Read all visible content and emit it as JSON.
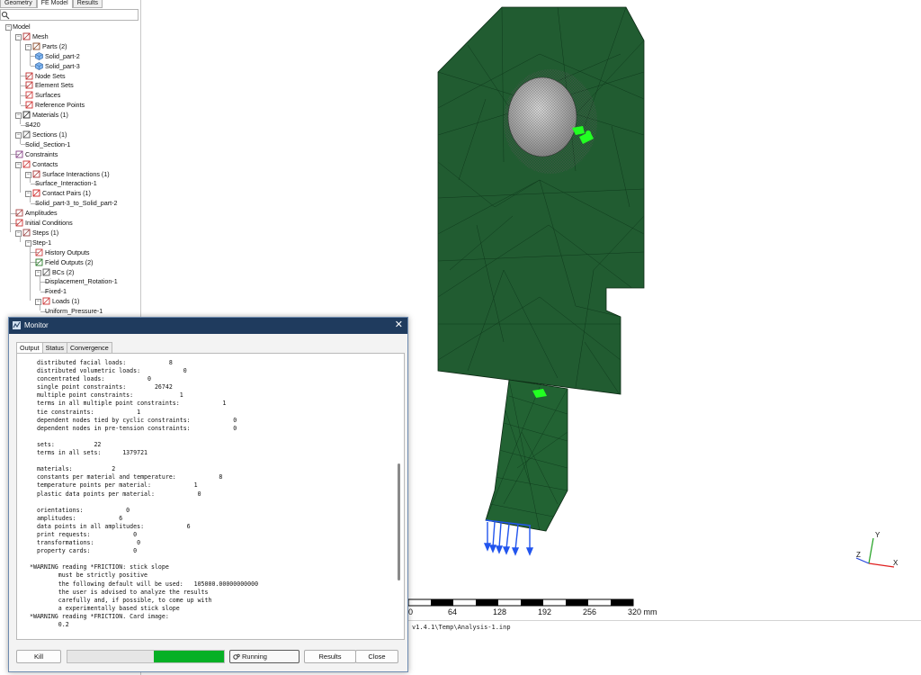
{
  "left_panel": {
    "tabs": [
      {
        "label": "Geometry",
        "active": false
      },
      {
        "label": "FE Model",
        "active": true
      },
      {
        "label": "Results",
        "active": false
      }
    ],
    "search_placeholder": "",
    "tree": [
      {
        "label": "Model",
        "icon": "none",
        "level": 0
      },
      {
        "label": "Mesh",
        "icon": "mesh-icon",
        "level": 1
      },
      {
        "label": "Parts (2)",
        "icon": "parts-icon",
        "level": 2
      },
      {
        "label": "Solid_part-2",
        "icon": "solid-part-icon",
        "level": 3
      },
      {
        "label": "Solid_part-3",
        "icon": "solid-part-icon",
        "level": 3
      },
      {
        "label": "Node Sets",
        "icon": "node-sets-icon",
        "level": 2
      },
      {
        "label": "Element Sets",
        "icon": "element-sets-icon",
        "level": 2
      },
      {
        "label": "Surfaces",
        "icon": "surfaces-icon",
        "level": 2
      },
      {
        "label": "Reference Points",
        "icon": "reference-points-icon",
        "level": 2
      },
      {
        "label": "Materials (1)",
        "icon": "materials-icon",
        "level": 1
      },
      {
        "label": "S420",
        "icon": "none",
        "level": 2
      },
      {
        "label": "Sections (1)",
        "icon": "sections-icon",
        "level": 1
      },
      {
        "label": "Solid_Section-1",
        "icon": "none",
        "level": 2
      },
      {
        "label": "Constraints",
        "icon": "constraints-icon",
        "level": 1
      },
      {
        "label": "Contacts",
        "icon": "contacts-icon",
        "level": 1
      },
      {
        "label": "Surface Interactions (1)",
        "icon": "surface-interactions-icon",
        "level": 2
      },
      {
        "label": "Surface_Interaction-1",
        "icon": "none",
        "level": 3
      },
      {
        "label": "Contact Pairs (1)",
        "icon": "contact-pairs-icon",
        "level": 2
      },
      {
        "label": "Solid_part-3_to_Solid_part-2",
        "icon": "none",
        "level": 3
      },
      {
        "label": "Amplitudes",
        "icon": "amplitudes-icon",
        "level": 1
      },
      {
        "label": "Initial Conditions",
        "icon": "initial-conditions-icon",
        "level": 1
      },
      {
        "label": "Steps (1)",
        "icon": "steps-icon",
        "level": 1
      },
      {
        "label": "Step-1",
        "icon": "none",
        "level": 2
      },
      {
        "label": "History Outputs",
        "icon": "history-outputs-icon",
        "level": 3
      },
      {
        "label": "Field Outputs (2)",
        "icon": "field-outputs-icon",
        "level": 3
      },
      {
        "label": "BCs (2)",
        "icon": "bcs-icon",
        "level": 3
      },
      {
        "label": "Displacement_Rotation-1",
        "icon": "none",
        "level": 4
      },
      {
        "label": "Fixed-1",
        "icon": "none",
        "level": 4
      },
      {
        "label": "Loads (1)",
        "icon": "loads-icon",
        "level": 3
      },
      {
        "label": "Uniform_Pressure-1",
        "icon": "none",
        "level": 4
      }
    ]
  },
  "viewport": {
    "scale_ticks": [
      "0",
      "64",
      "128",
      "192",
      "256",
      "320 mm"
    ],
    "axis_labels": {
      "x": "X",
      "y": "Y",
      "z": "Z"
    },
    "colors": {
      "mesh": "#1f5b30",
      "hole": "#c8c8c8",
      "bc": "#22ff22",
      "load": "#2255ee"
    }
  },
  "console": {
    "text": "v1.4.1\\Temp\\Analysis-1.inp"
  },
  "monitor": {
    "title": "Monitor",
    "close_glyph": "✕",
    "tabs": [
      {
        "label": "Output",
        "active": true
      },
      {
        "label": "Status",
        "active": false
      },
      {
        "label": "Convergence",
        "active": false
      }
    ],
    "output_lines": [
      "  distributed facial loads:            8",
      "  distributed volumetric loads:            0",
      "  concentrated loads:            0",
      "  single point constraints:        26742",
      "  multiple point constraints:             1",
      "  terms in all multiple point constraints:            1",
      "  tie constraints:            1",
      "  dependent nodes tied by cyclic constraints:            0",
      "  dependent nodes in pre-tension constraints:            0",
      "",
      "  sets:           22",
      "  terms in all sets:      1379721",
      "",
      "  materials:           2",
      "  constants per material and temperature:            8",
      "  temperature points per material:            1",
      "  plastic data points per material:            0",
      "",
      "  orientations:            0",
      "  amplitudes:            6",
      "  data points in all amplitudes:            6",
      "  print requests:            0",
      "  transformations:            0",
      "  property cards:            0",
      "",
      "*WARNING reading *FRICTION: stick slope",
      "        must be strictly positive",
      "        the following default will be used:   105000.00000000000",
      "        the user is advised to analyze the results",
      "        carefully and, if possible, to come up with",
      "        a experimentally based stick slope",
      "*WARNING reading *FRICTION. Card image:",
      "        0.2"
    ],
    "kill_label": "Kill",
    "progress": 0.45,
    "status_label": "Running",
    "results_label": "Results",
    "close_label": "Close",
    "progress_color": "#06b025"
  }
}
